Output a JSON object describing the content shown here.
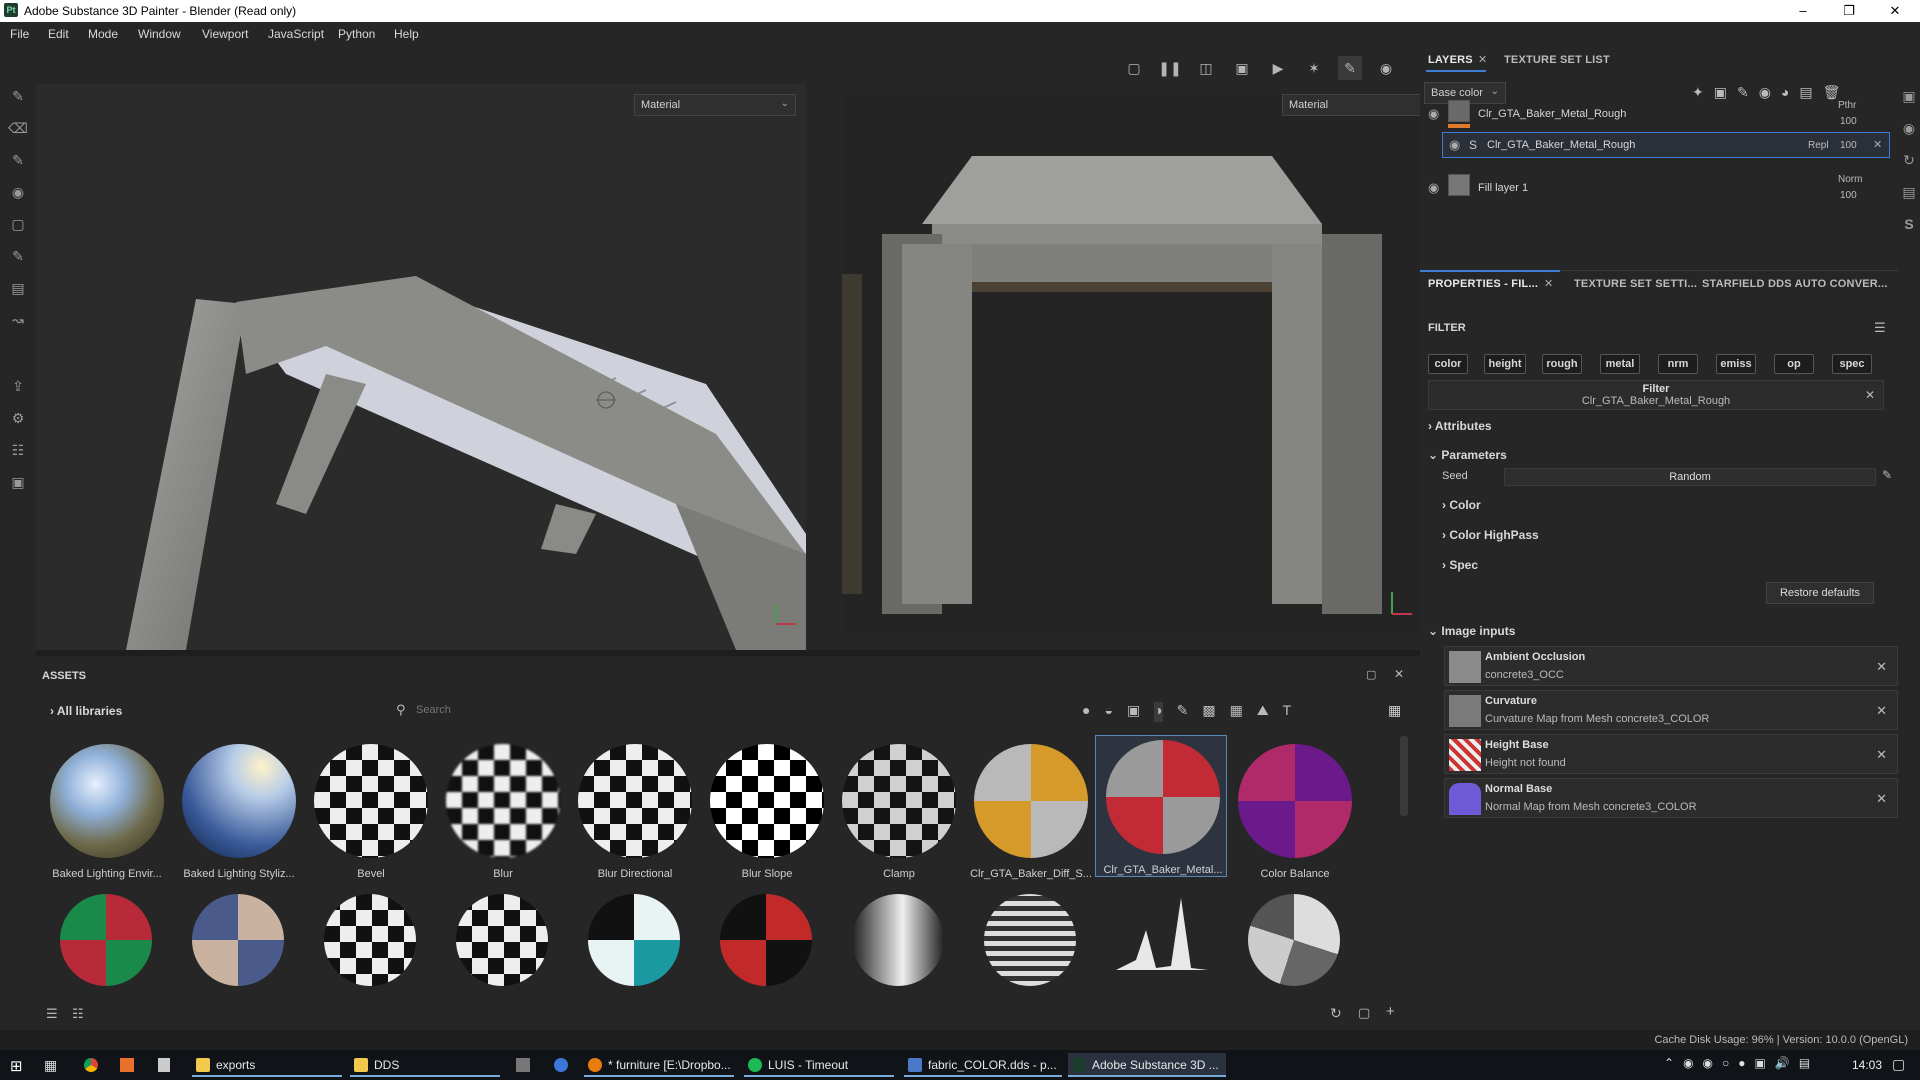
{
  "window": {
    "title": "Adobe Substance 3D Painter - Blender (Read only)",
    "app_icon": "Pt"
  },
  "menu": [
    "File",
    "Edit",
    "Mode",
    "Window",
    "Viewport",
    "JavaScript",
    "Python",
    "Help"
  ],
  "viewport": {
    "left_material": "Material",
    "right_material": "Material"
  },
  "layers_panel": {
    "tabs": [
      "LAYERS",
      "TEXTURE SET LIST"
    ],
    "channel": "Base color",
    "layers": [
      {
        "name": "Clr_GTA_Baker_Metal_Rough",
        "blend": "Pthr",
        "opacity": "100"
      },
      {
        "name": "Clr_GTA_Baker_Metal_Rough",
        "blend": "Repl",
        "opacity": "100"
      },
      {
        "name": "Fill layer 1",
        "blend": "Norm",
        "opacity": "100"
      }
    ]
  },
  "properties": {
    "tabs": [
      "PROPERTIES - FIL...",
      "TEXTURE SET SETTI...",
      "STARFIELD DDS AUTO CONVER..."
    ],
    "filter_title": "FILTER",
    "chips": [
      "color",
      "height",
      "rough",
      "metal",
      "nrm",
      "emiss",
      "op",
      "spec"
    ],
    "filter_box": {
      "label": "Filter",
      "value": "Clr_GTA_Baker_Metal_Rough"
    },
    "attributes": "Attributes",
    "parameters": "Parameters",
    "seed_label": "Seed",
    "seed_value": "Random",
    "groups": [
      "Color",
      "Color HighPass",
      "Spec"
    ],
    "restore": "Restore defaults",
    "image_inputs_title": "Image inputs",
    "image_inputs": [
      {
        "name": "Ambient Occlusion",
        "value": "concrete3_OCC"
      },
      {
        "name": "Curvature",
        "value": "Curvature Map from Mesh concrete3_COLOR"
      },
      {
        "name": "Height Base",
        "value": "Height not found"
      },
      {
        "name": "Normal Base",
        "value": "Normal Map from Mesh concrete3_COLOR"
      }
    ]
  },
  "assets": {
    "title": "ASSETS",
    "library": "All libraries",
    "search_placeholder": "Search",
    "row1": [
      "Baked Lighting Envir...",
      "Baked Lighting Styliz...",
      "Bevel",
      "Blur",
      "Blur Directional",
      "Blur Slope",
      "Clamp",
      "Clr_GTA_Baker_Diff_S...",
      "Clr_GTA_Baker_Metal...",
      "Color Balance"
    ]
  },
  "status": {
    "text": "Cache Disk Usage:   96% | Version: 10.0.0 (OpenGL)"
  },
  "taskbar": {
    "items": [
      "exports",
      "DDS",
      "* furniture [E:\\Dropbo...",
      "LUIS - Timeout",
      "fabric_COLOR.dds - p...",
      "Adobe Substance 3D ..."
    ],
    "clock": "14:03"
  }
}
